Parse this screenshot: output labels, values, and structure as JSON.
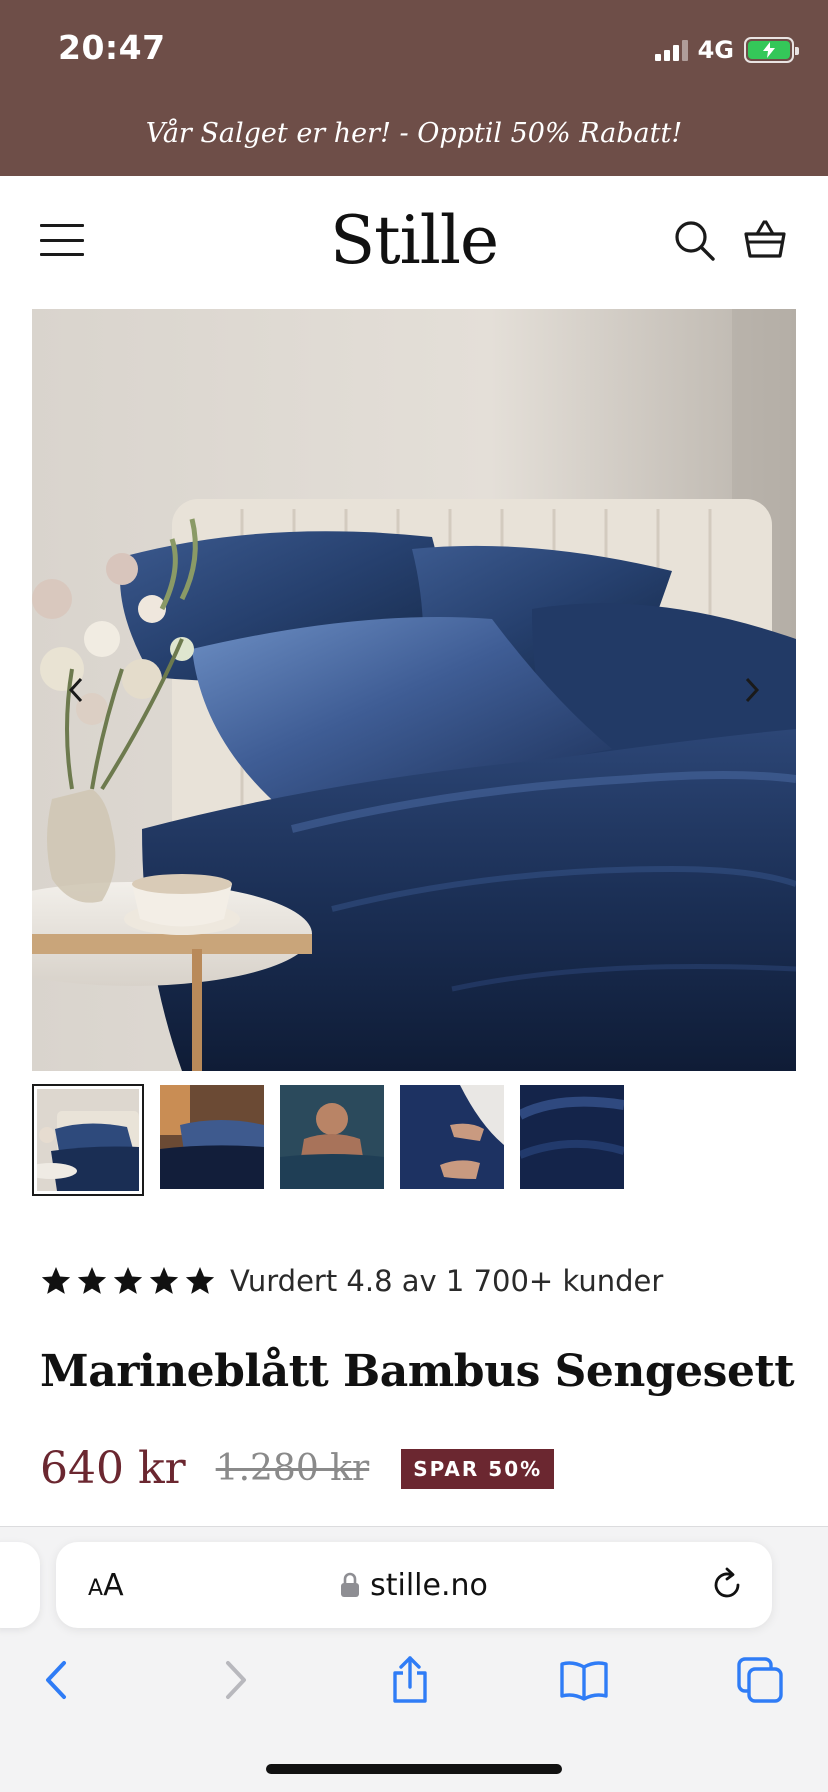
{
  "status_bar": {
    "time": "20:47",
    "network": "4G",
    "battery_percent": 80
  },
  "promo": {
    "text": "Vår Salget er her! - Opptil 50% Rabatt!"
  },
  "header": {
    "logo": "Stille",
    "icons": [
      "menu-icon",
      "search-icon",
      "cart-icon"
    ]
  },
  "gallery": {
    "main_image": "navy-satin-bedding-photo",
    "thumbnails": [
      "bed-overview",
      "bed-with-lamp",
      "man-in-bed",
      "hand-on-sheet",
      "fabric-closeup"
    ],
    "active_index": 0
  },
  "product": {
    "rating_stars": 5,
    "rating_text": "Vurdert 4.8 av 1 700+ kunder",
    "title": "Marineblått Bambus Sengesett",
    "price": "640 kr",
    "original_price": "1.280 kr",
    "badge": "SPAR 50%"
  },
  "browser": {
    "aa_small": "A",
    "aa_big": "A",
    "url": "stille.no"
  },
  "colors": {
    "brand_band": "#6e4e48",
    "sale_accent": "#6b2730",
    "safari_blue": "#2f7cf6"
  }
}
